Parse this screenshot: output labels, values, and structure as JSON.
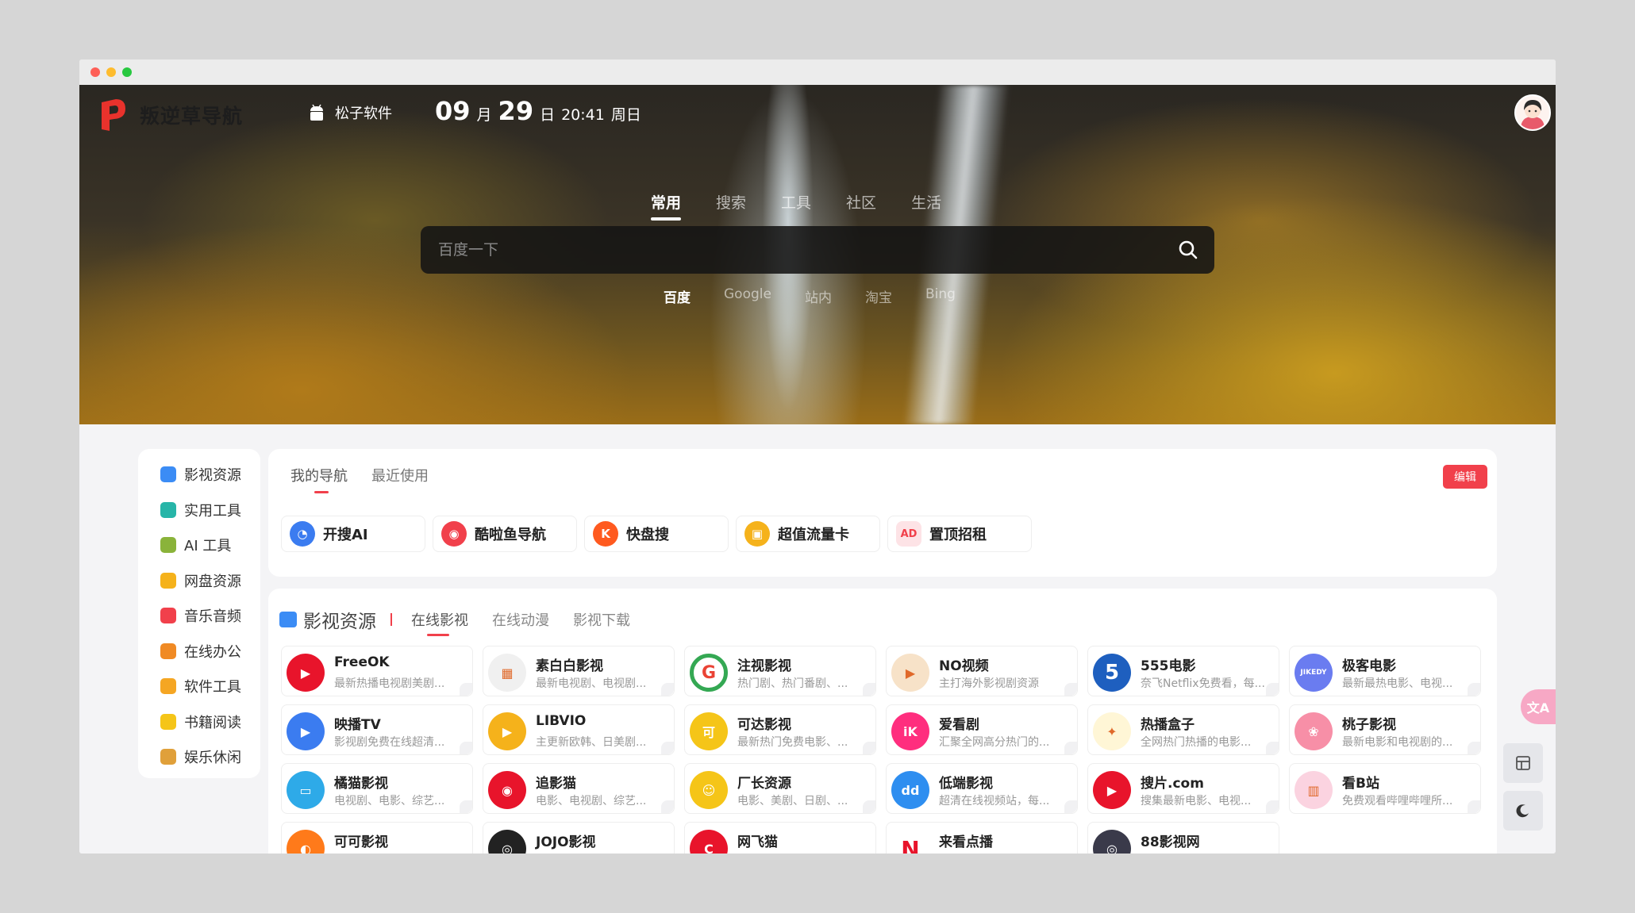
{
  "header": {
    "logo_text": "叛逆草导航",
    "site_link": "松子软件",
    "clock": {
      "month": "09",
      "month_unit": "月",
      "day": "29",
      "day_unit": "日",
      "time": "20:41",
      "weekday": "周日"
    }
  },
  "hero": {
    "tabs": [
      {
        "label": "常用",
        "active": true
      },
      {
        "label": "搜索",
        "active": false
      },
      {
        "label": "工具",
        "active": false
      },
      {
        "label": "社区",
        "active": false
      },
      {
        "label": "生活",
        "active": false
      }
    ],
    "search_placeholder": "百度一下",
    "engines": [
      {
        "label": "百度",
        "active": true
      },
      {
        "label": "Google",
        "active": false
      },
      {
        "label": "站内",
        "active": false
      },
      {
        "label": "淘宝",
        "active": false
      },
      {
        "label": "Bing",
        "active": false
      }
    ]
  },
  "sidebar": {
    "items": [
      {
        "label": "影视资源",
        "icon": "video-icon",
        "color": "#3b8cf5"
      },
      {
        "label": "实用工具",
        "icon": "wrench-icon",
        "color": "#27b5a8"
      },
      {
        "label": "AI 工具",
        "icon": "robot-icon",
        "color": "#8ab33a"
      },
      {
        "label": "网盘资源",
        "icon": "folder-icon",
        "color": "#f5b21b"
      },
      {
        "label": "音乐音频",
        "icon": "headphone-icon",
        "color": "#f1404b"
      },
      {
        "label": "在线办公",
        "icon": "briefcase-icon",
        "color": "#f08a24"
      },
      {
        "label": "软件工具",
        "icon": "software-icon",
        "color": "#f5a623"
      },
      {
        "label": "书籍阅读",
        "icon": "book-icon",
        "color": "#f5c518"
      },
      {
        "label": "娱乐休闲",
        "icon": "person-icon",
        "color": "#e0a03a"
      }
    ]
  },
  "mynav": {
    "tabs": [
      {
        "label": "我的导航",
        "active": true
      },
      {
        "label": "最近使用",
        "active": false
      }
    ],
    "edit_label": "编辑",
    "items": [
      {
        "label": "开搜AI",
        "icon": "kaisou-icon",
        "color": "#3b7cf0",
        "glyph": "◔"
      },
      {
        "label": "酷啦鱼导航",
        "icon": "kulayu-icon",
        "color": "#f1404b",
        "glyph": "◉"
      },
      {
        "label": "快盘搜",
        "icon": "kuaipan-icon",
        "color": "#ff5a1f",
        "glyph": "K"
      },
      {
        "label": "超值流量卡",
        "icon": "simcard-icon",
        "color": "#f5b21b",
        "glyph": "▣"
      },
      {
        "label": "置顶招租",
        "icon": "ad-icon",
        "color": "#fde3e6",
        "glyph": "AD"
      }
    ]
  },
  "resources": {
    "title": "影视资源",
    "tabs": [
      {
        "label": "在线影视",
        "active": true
      },
      {
        "label": "在线动漫",
        "active": false
      },
      {
        "label": "影视下载",
        "active": false
      }
    ],
    "cards": [
      {
        "name": "FreeOK",
        "desc": "最新热播电视剧美剧...",
        "icon": "freeok-icon",
        "color": "#e8142b",
        "glyph": "▶"
      },
      {
        "name": "素白白影视",
        "desc": "最新电视剧、电视剧...",
        "icon": "subaibai-icon",
        "color": "#f0f0f0",
        "glyph": "▦"
      },
      {
        "name": "注视影视",
        "desc": "热门剧、热门番剧、...",
        "icon": "zhushi-icon",
        "color": "#34a853",
        "glyph": "G"
      },
      {
        "name": "NO视频",
        "desc": "主打海外影视剧资源",
        "icon": "novideo-icon",
        "color": "#f7e2c8",
        "glyph": "▶"
      },
      {
        "name": "555电影",
        "desc": "奈飞Netflix免费看，每...",
        "icon": "555-icon",
        "color": "#1e5fbf",
        "glyph": "5"
      },
      {
        "name": "极客电影",
        "desc": "最新最热电影、电视...",
        "icon": "jikedy-icon",
        "color": "#6a7cf0",
        "glyph": "JIKEDY"
      },
      {
        "name": "映播TV",
        "desc": "影视剧免费在线超清...",
        "icon": "yingbo-icon",
        "color": "#3b7cf0",
        "glyph": "▶"
      },
      {
        "name": "LIBVIO",
        "desc": "主更新欧韩、日美剧...",
        "icon": "libvio-icon",
        "color": "#f5b21b",
        "glyph": "▶"
      },
      {
        "name": "可达影视",
        "desc": "最新热门免费电影、...",
        "icon": "keda-icon",
        "color": "#f5c518",
        "glyph": "可"
      },
      {
        "name": "爱看剧",
        "desc": "汇聚全网高分热门的...",
        "icon": "aikanju-icon",
        "color": "#ff2e7e",
        "glyph": "iK"
      },
      {
        "name": "热播盒子",
        "desc": "全网热门热播的电影...",
        "icon": "rebohezi-icon",
        "color": "#fff6d6",
        "glyph": "✦"
      },
      {
        "name": "桃子影视",
        "desc": "最新电影和电视剧的...",
        "icon": "taozi-icon",
        "color": "#f78fa7",
        "glyph": "❀"
      },
      {
        "name": "橘猫影视",
        "desc": "电视剧、电影、综艺...",
        "icon": "jumao-icon",
        "color": "#2eaae8",
        "glyph": "▭"
      },
      {
        "name": "追影猫",
        "desc": "电影、电视剧、综艺...",
        "icon": "zhuiyingmao-icon",
        "color": "#e8142b",
        "glyph": "◉"
      },
      {
        "name": "厂长资源",
        "desc": "电影、美剧、日剧、...",
        "icon": "changzhang-icon",
        "color": "#f5c518",
        "glyph": "☺"
      },
      {
        "name": "低端影视",
        "desc": "超清在线视频站，每...",
        "icon": "diduan-icon",
        "color": "#2e8ef0",
        "glyph": "dd"
      },
      {
        "name": "搜片.com",
        "desc": "搜集最新电影、电视...",
        "icon": "soupian-icon",
        "color": "#e8142b",
        "glyph": "▶"
      },
      {
        "name": "看B站",
        "desc": "免费观看哔哩哔哩所...",
        "icon": "kanbzhan-icon",
        "color": "#fbd3e0",
        "glyph": "▥"
      },
      {
        "name": "可可影视",
        "desc": "",
        "icon": "keke-icon",
        "color": "#ff7a1a",
        "glyph": "◐"
      },
      {
        "name": "JOJO影视",
        "desc": "",
        "icon": "jojo-icon",
        "color": "#222222",
        "glyph": "◎"
      },
      {
        "name": "网飞猫",
        "desc": "",
        "icon": "wangfeimao-icon",
        "color": "#e8142b",
        "glyph": "C"
      },
      {
        "name": "来看点播",
        "desc": "",
        "icon": "laikan-icon",
        "color": "#ffffff",
        "glyph": "N"
      },
      {
        "name": "88影视网",
        "desc": "",
        "icon": "88-icon",
        "color": "#3a3a4a",
        "glyph": "◎"
      }
    ]
  },
  "floating": {
    "translate_label": "文A"
  }
}
